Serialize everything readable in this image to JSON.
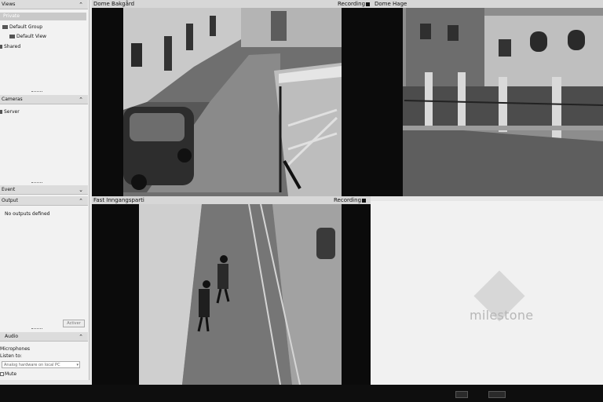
{
  "views": {
    "header": "Views",
    "items": [
      {
        "label": "Private"
      },
      {
        "label": "Default Group"
      },
      {
        "label": "Default View"
      },
      {
        "label": "Shared"
      }
    ]
  },
  "cameras": {
    "header": "Cameras",
    "items": [
      {
        "label": "Server"
      }
    ]
  },
  "event": {
    "header": "Event"
  },
  "output": {
    "header": "Output",
    "empty_text": "No outputs defined",
    "activate_label": "Activer"
  },
  "audio": {
    "header": "Audio",
    "microphones_label": "Microphones",
    "listen_label": "Listen to:",
    "listen_value": "Analog hardware on local PC",
    "mute_label": "Mute"
  },
  "panes": {
    "top_left": {
      "title": "Dome Bakgård",
      "status": "Recording"
    },
    "top_right": {
      "title": "Dome Hage",
      "status": ""
    },
    "bottom_left": {
      "title": "Fast Inngangsparti",
      "status": "Recording"
    }
  },
  "brand": {
    "logo_text": "milestone"
  }
}
